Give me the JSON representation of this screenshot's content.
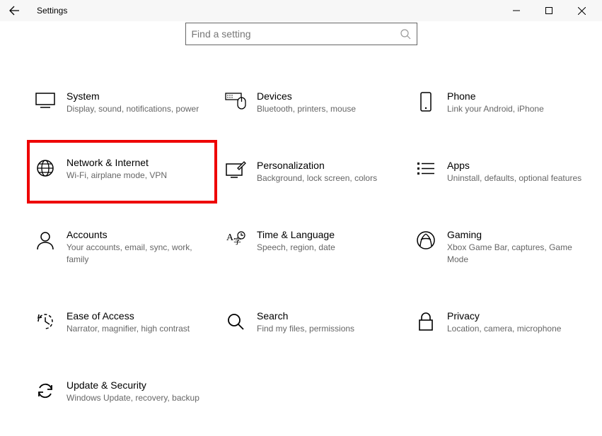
{
  "window": {
    "title": "Settings"
  },
  "search": {
    "placeholder": "Find a setting"
  },
  "tiles": {
    "system": {
      "title": "System",
      "desc": "Display, sound, notifications, power"
    },
    "devices": {
      "title": "Devices",
      "desc": "Bluetooth, printers, mouse"
    },
    "phone": {
      "title": "Phone",
      "desc": "Link your Android, iPhone"
    },
    "network": {
      "title": "Network & Internet",
      "desc": "Wi-Fi, airplane mode, VPN"
    },
    "personalization": {
      "title": "Personalization",
      "desc": "Background, lock screen, colors"
    },
    "apps": {
      "title": "Apps",
      "desc": "Uninstall, defaults, optional features"
    },
    "accounts": {
      "title": "Accounts",
      "desc": "Your accounts, email, sync, work, family"
    },
    "time": {
      "title": "Time & Language",
      "desc": "Speech, region, date"
    },
    "gaming": {
      "title": "Gaming",
      "desc": "Xbox Game Bar, captures, Game Mode"
    },
    "ease": {
      "title": "Ease of Access",
      "desc": "Narrator, magnifier, high contrast"
    },
    "search_cat": {
      "title": "Search",
      "desc": "Find my files, permissions"
    },
    "privacy": {
      "title": "Privacy",
      "desc": "Location, camera, microphone"
    },
    "update": {
      "title": "Update & Security",
      "desc": "Windows Update, recovery, backup"
    }
  }
}
